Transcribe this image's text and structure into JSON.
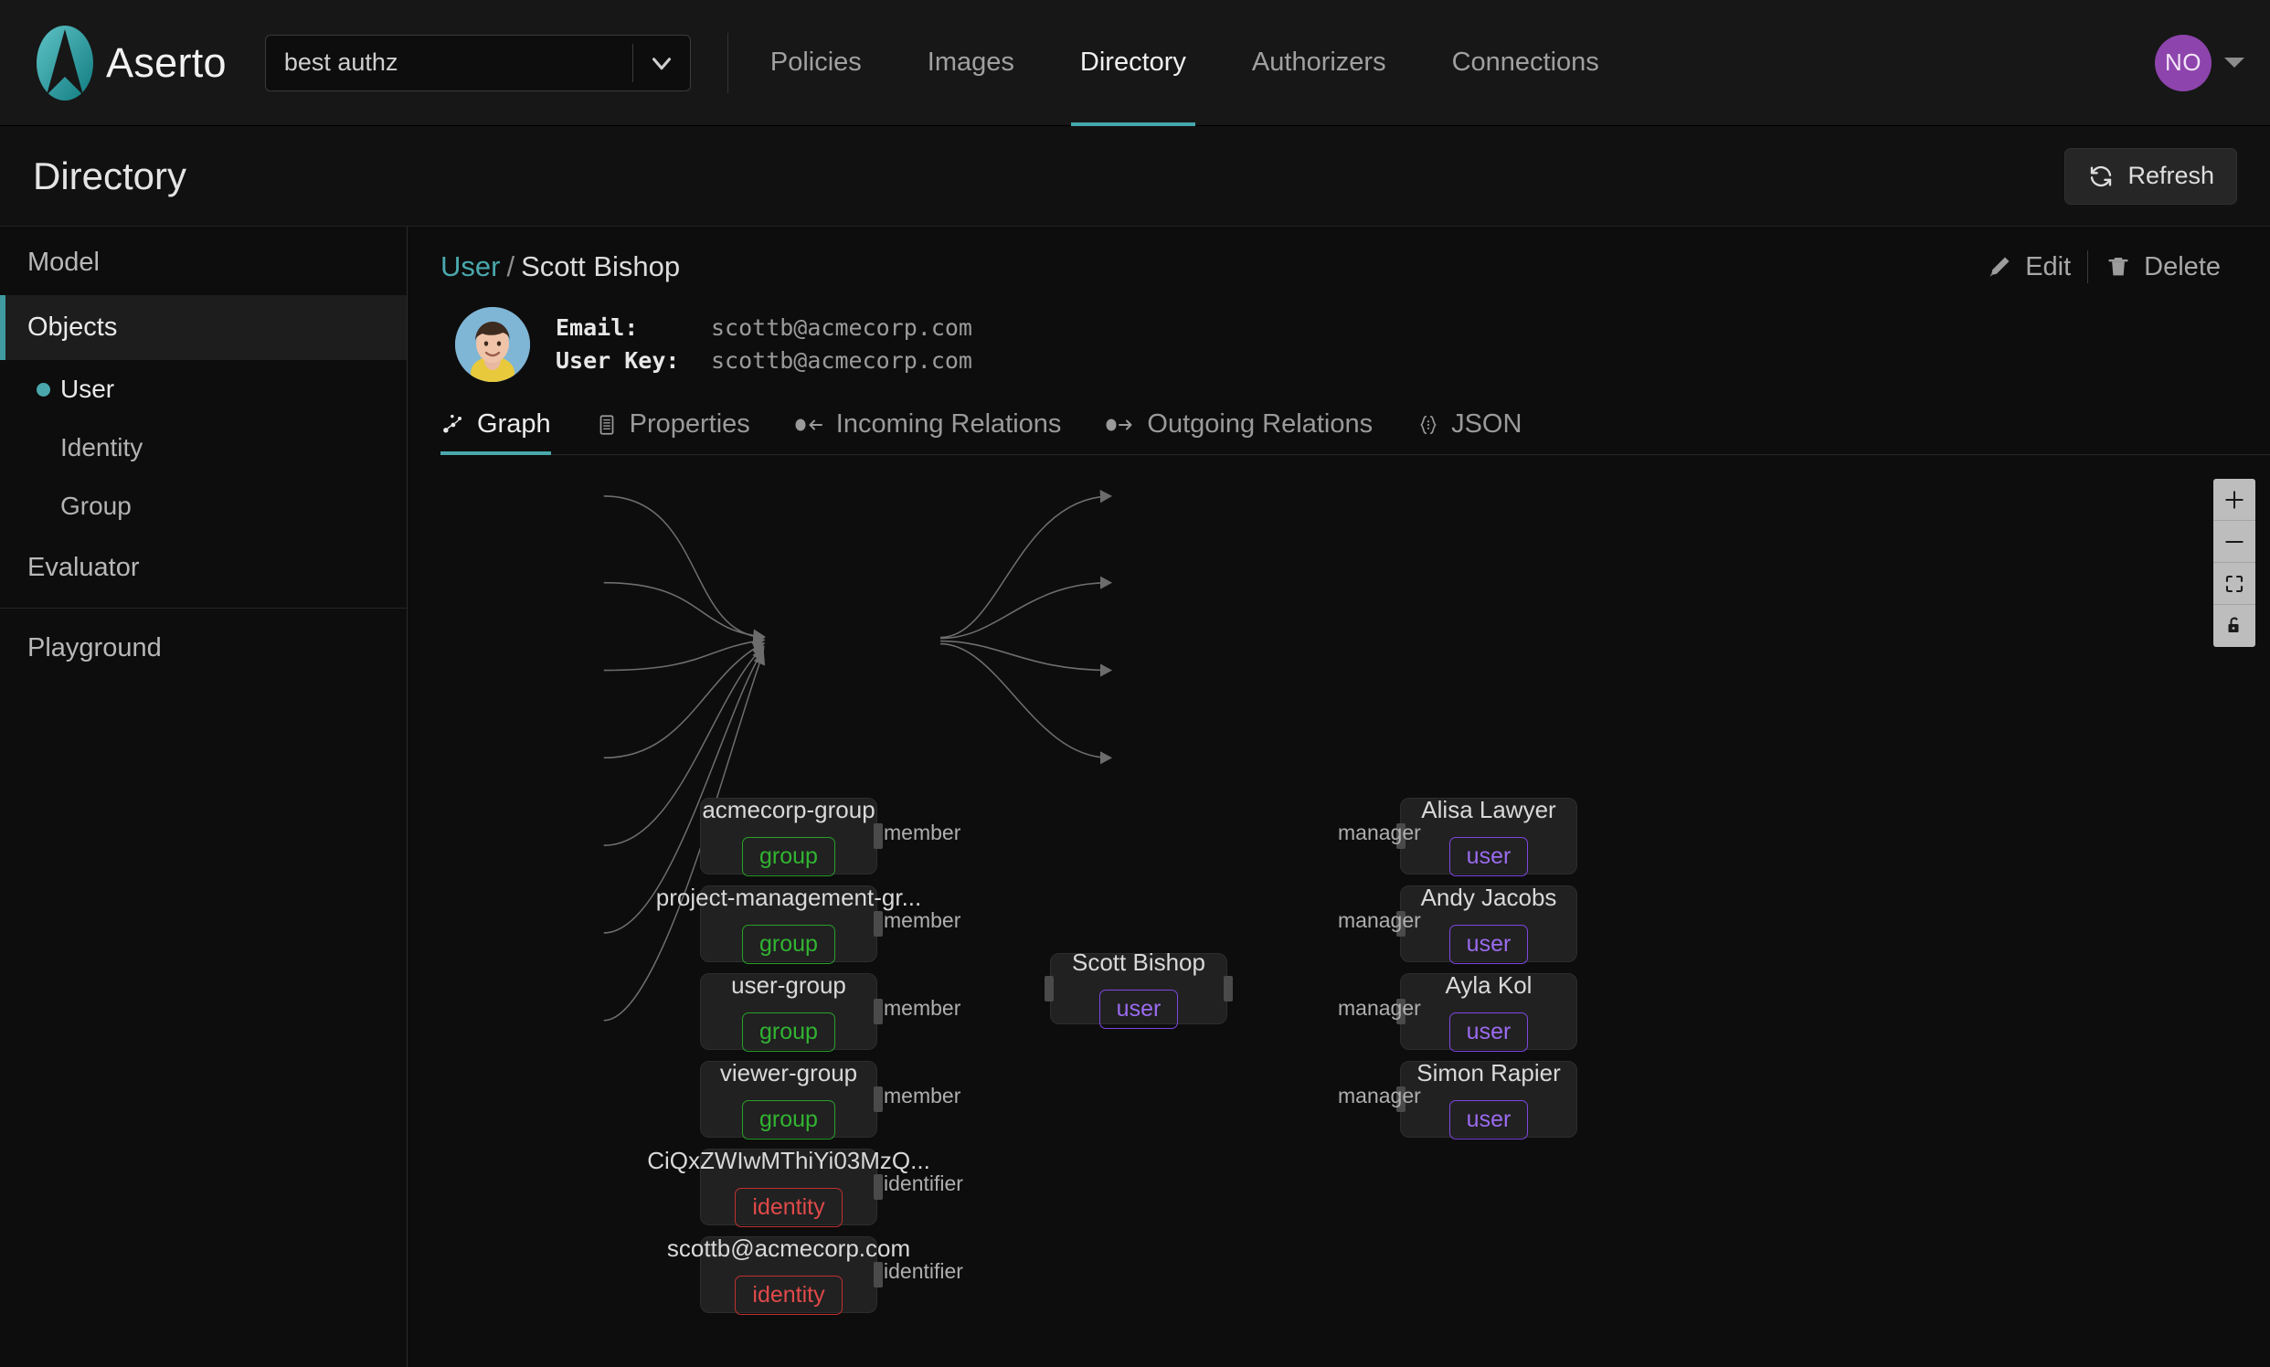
{
  "topbar": {
    "brand": "Aserto",
    "logo_icon": "aserto-logo-icon",
    "tenant": {
      "value": "best authz",
      "chevron_icon": "chevron-down-icon"
    },
    "nav": [
      {
        "label": "Policies",
        "active": false
      },
      {
        "label": "Images",
        "active": false
      },
      {
        "label": "Directory",
        "active": true
      },
      {
        "label": "Authorizers",
        "active": false
      },
      {
        "label": "Connections",
        "active": false
      }
    ],
    "account": {
      "initials": "NO",
      "avatar_color": "#8e44ad",
      "caret_icon": "caret-down-icon"
    }
  },
  "page": {
    "title": "Directory",
    "refresh": {
      "label": "Refresh",
      "icon": "refresh-icon"
    }
  },
  "sidebar": {
    "items": [
      {
        "label": "Model",
        "active": false
      },
      {
        "label": "Objects",
        "active": true
      }
    ],
    "sub_items": [
      {
        "label": "User",
        "selected": true
      },
      {
        "label": "Identity",
        "selected": false
      },
      {
        "label": "Group",
        "selected": false
      }
    ],
    "items_after": [
      {
        "label": "Evaluator",
        "active": false
      }
    ],
    "items_footer": [
      {
        "label": "Playground",
        "active": false
      }
    ]
  },
  "detail": {
    "breadcrumb": {
      "root": "User",
      "separator": "/",
      "current": "Scott Bishop"
    },
    "actions": {
      "edit": "Edit",
      "edit_icon": "pencil-icon",
      "delete": "Delete",
      "delete_icon": "trash-icon"
    },
    "avatar_icon": "user-photo-avatar",
    "fields": [
      {
        "key": "Email:",
        "value": "scottb@acmecorp.com"
      },
      {
        "key": "User Key:",
        "value": "scottb@acmecorp.com"
      }
    ],
    "tabs": [
      {
        "label": "Graph",
        "icon": "graph-icon",
        "active": true
      },
      {
        "label": "Properties",
        "icon": "list-icon",
        "active": false
      },
      {
        "label": "Incoming Relations",
        "icon": "arrow-in-icon",
        "active": false
      },
      {
        "label": "Outgoing Relations",
        "icon": "arrow-out-icon",
        "active": false
      },
      {
        "label": "JSON",
        "icon": "braces-icon",
        "active": false
      }
    ]
  },
  "graph": {
    "center_node": {
      "title": "Scott Bishop",
      "type": "user"
    },
    "left_nodes": [
      {
        "title": "acmecorp-group",
        "type": "group",
        "edge_label": "member"
      },
      {
        "title": "project-management-gr...",
        "type": "group",
        "edge_label": "member"
      },
      {
        "title": "user-group",
        "type": "group",
        "edge_label": "member"
      },
      {
        "title": "viewer-group",
        "type": "group",
        "edge_label": "member"
      },
      {
        "title": "CiQxZWIwMThiYi03MzQ...",
        "type": "identity",
        "edge_label": "identifier"
      },
      {
        "title": "scottb@acmecorp.com",
        "type": "identity",
        "edge_label": "identifier"
      }
    ],
    "right_nodes": [
      {
        "title": "Alisa Lawyer",
        "type": "user",
        "edge_label": "manager"
      },
      {
        "title": "Andy Jacobs",
        "type": "user",
        "edge_label": "manager"
      },
      {
        "title": "Ayla Kol",
        "type": "user",
        "edge_label": "manager"
      },
      {
        "title": "Simon Rapier",
        "type": "user",
        "edge_label": "manager"
      }
    ],
    "controls": [
      {
        "name": "zoom-in",
        "icon": "plus-icon"
      },
      {
        "name": "zoom-out",
        "icon": "minus-icon"
      },
      {
        "name": "fit-view",
        "icon": "fit-view-icon"
      },
      {
        "name": "lock",
        "icon": "lock-icon"
      }
    ],
    "badge_colors": {
      "group": "#32b432",
      "identity": "#e04a4a",
      "user": "#9b6bf0"
    }
  }
}
